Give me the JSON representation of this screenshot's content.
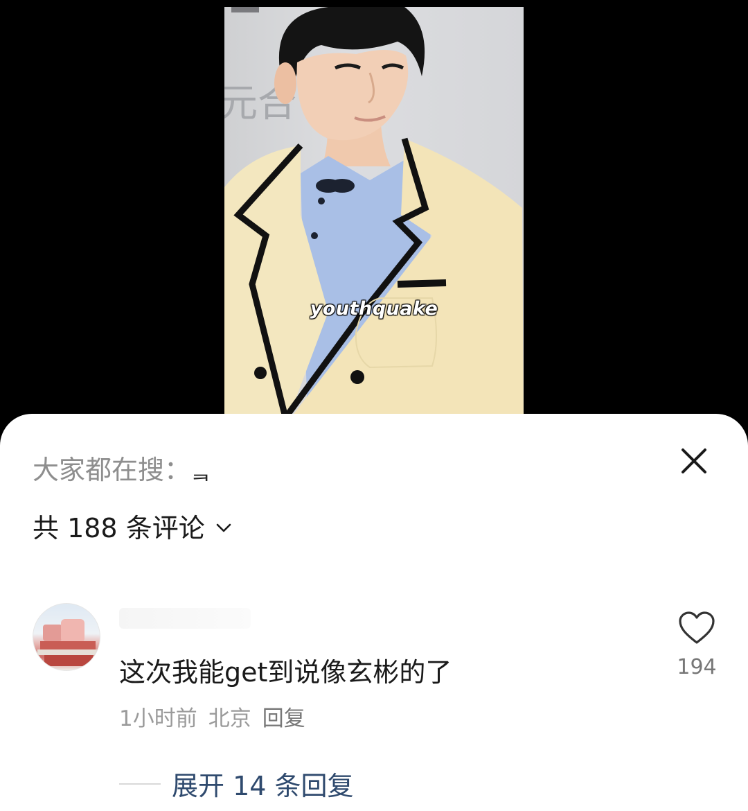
{
  "video": {
    "watermark": "youthquake"
  },
  "panel": {
    "search_prefix": "大家都在搜：",
    "search_term": "ᆿ",
    "comment_count_label": "共 188 条评论"
  },
  "comment": {
    "text": "这次我能get到说像玄彬的了",
    "time": "1小时前",
    "location": "北京",
    "reply_label": "回复",
    "likes": "194",
    "expand_label": "展开 14 条回复"
  },
  "icons": {
    "close": "close-icon",
    "chevron": "chevron-down-icon",
    "like": "heart-outline-icon"
  }
}
